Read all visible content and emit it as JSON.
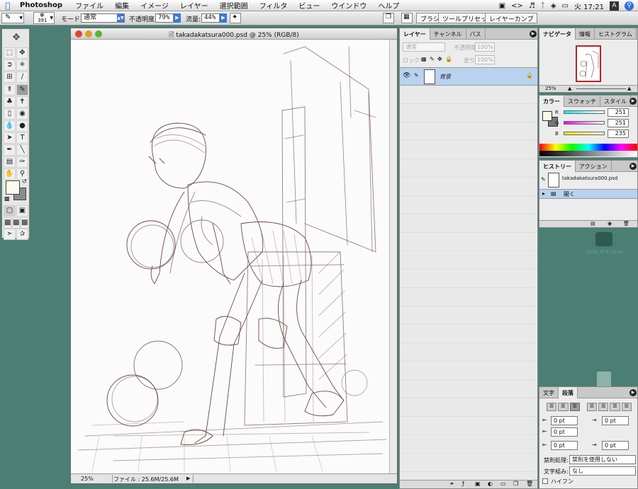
{
  "menubar": {
    "app_name": "Photoshop",
    "items": [
      "ファイル",
      "編集",
      "イメージ",
      "レイヤー",
      "選択範囲",
      "フィルタ",
      "ビュー",
      "ウインドウ",
      "ヘルプ"
    ],
    "clock": "火 17:21",
    "input_indicator": "A"
  },
  "options_bar": {
    "brush_size": "391",
    "mode_label": "モード:",
    "mode_value": "通常",
    "opacity_label": "不透明度:",
    "opacity_value": "79%",
    "flow_label": "流量:",
    "flow_value": "44%",
    "palette_tabs": [
      "ブラシ",
      "ツールプリセット",
      "レイヤーカンプ"
    ]
  },
  "document": {
    "title": "takadakatsura000.psd @ 25% (RGB/8)",
    "zoom": "25%",
    "file_info": "ファイル : 25.6M/25.6M"
  },
  "layers_palette": {
    "tabs": [
      "レイヤー",
      "チャンネル",
      "パス"
    ],
    "blend_mode": "通常",
    "opacity_label": "不透明度:",
    "opacity_value": "100%",
    "lock_label": "ロック:",
    "fill_label": "塗り:",
    "fill_value": "100%",
    "layer_name": "背景"
  },
  "navigator": {
    "tabs": [
      "ナビゲータ",
      "情報",
      "ヒストグラム"
    ],
    "zoom": "25%"
  },
  "color_palette": {
    "tabs": [
      "カラー",
      "スウォッチ",
      "スタイル"
    ],
    "r_label": "R",
    "r_value": "251",
    "g_label": "G",
    "g_value": "251",
    "b_label": "B",
    "b_value": "235",
    "foreground": "#fbfbeb"
  },
  "history_palette": {
    "tabs": [
      "ヒストリー",
      "アクション"
    ],
    "snapshot_name": "takadakatsura000.psd",
    "step_name": "開く"
  },
  "desktop": {
    "file_label": "DVD_(C4) prod"
  },
  "paragraph_palette": {
    "tabs": [
      "文字",
      "段落"
    ],
    "indent_left": "0 pt",
    "indent_right": "0 pt",
    "indent_first": "0 pt",
    "space_before": "0 pt",
    "space_after": "0 pt",
    "kinsoku_label": "禁則処理:",
    "kinsoku_value": "禁則を使用しない",
    "mojikumi_label": "文字組み:",
    "mojikumi_value": "なし",
    "hyphen_label": "ハイフン"
  }
}
